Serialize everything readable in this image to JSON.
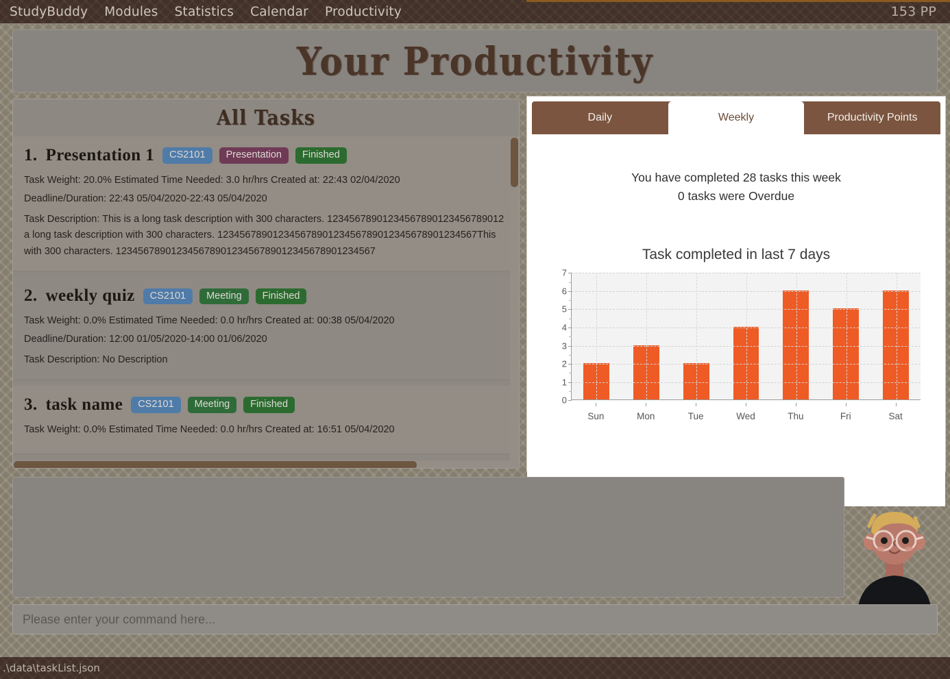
{
  "menubar": {
    "items": [
      {
        "label": "StudyBuddy"
      },
      {
        "label": "Modules"
      },
      {
        "label": "Statistics"
      },
      {
        "label": "Calendar"
      },
      {
        "label": "Productivity"
      }
    ],
    "points": "153 PP"
  },
  "header": {
    "title": "Your Productivity"
  },
  "tasks_panel": {
    "title": "All Tasks",
    "items": [
      {
        "index": "1.",
        "name": "Presentation 1",
        "tags": [
          {
            "label": "CS2101",
            "color": "#4f7ba8"
          },
          {
            "label": "Presentation",
            "color": "#6f3a55"
          },
          {
            "label": "Finished",
            "color": "#2c6b2f"
          }
        ],
        "meta": "Task Weight: 20.0%   Estimated Time Needed: 3.0 hr/hrs   Created at: 22:43 02/04/2020",
        "deadline": "Deadline/Duration: 22:43 05/04/2020-22:43 05/04/2020",
        "description": "Task Description: This is a long task description with 300 characters. 12345678901234567890123456789012\na long task description with 300 characters. 12345678901234567890123456789012345678901234567This\nwith 300 characters. 12345678901234567890123456789012345678901234567"
      },
      {
        "index": "2.",
        "name": "weekly quiz",
        "tags": [
          {
            "label": "CS2101",
            "color": "#4f7ba8"
          },
          {
            "label": "Meeting",
            "color": "#2f6b39"
          },
          {
            "label": "Finished",
            "color": "#2c6b2f"
          }
        ],
        "meta": "Task Weight: 0.0%   Estimated Time Needed: 0.0 hr/hrs   Created at: 00:38 05/04/2020",
        "deadline": "Deadline/Duration: 12:00 01/05/2020-14:00 01/06/2020",
        "description": "Task Description: No Description"
      },
      {
        "index": "3.",
        "name": "task name",
        "tags": [
          {
            "label": "CS2101",
            "color": "#4f7ba8"
          },
          {
            "label": "Meeting",
            "color": "#2f6b39"
          },
          {
            "label": "Finished",
            "color": "#2c6b2f"
          }
        ],
        "meta": "Task Weight: 0.0%   Estimated Time Needed: 0.0 hr/hrs   Created at: 16:51 05/04/2020",
        "deadline": "",
        "description": ""
      }
    ]
  },
  "stats_panel": {
    "tabs": [
      {
        "label": "Daily",
        "active": false
      },
      {
        "label": "Weekly",
        "active": true
      },
      {
        "label": "Productivity Points",
        "active": false
      }
    ],
    "summary_line1": "You have completed 28 tasks this week",
    "summary_line2": "0 tasks were Overdue"
  },
  "chart_data": {
    "type": "bar",
    "title": "Task completed in last 7 days",
    "categories": [
      "Sun",
      "Mon",
      "Tue",
      "Wed",
      "Thu",
      "Fri",
      "Sat"
    ],
    "values": [
      2,
      3,
      2,
      4,
      6,
      5,
      6
    ],
    "yticks": [
      0,
      1,
      2,
      3,
      4,
      5,
      6,
      7
    ],
    "ylim": [
      0,
      7
    ],
    "xlabel": "",
    "ylabel": "",
    "grid": true,
    "legend": "none",
    "bar_color": "#ef5b25",
    "plot_background": "#f3f3f3"
  },
  "command_input": {
    "placeholder": "Please enter your command here...",
    "value": ""
  },
  "statusbar": {
    "path": ".\\data\\taskList.json"
  },
  "colors": {
    "accent_brown": "#7b5540",
    "dark_brown": "#423128",
    "texture_bg": "#857e6e",
    "panel_gray": "#8d8882",
    "bar_orange": "#ef5b25"
  }
}
